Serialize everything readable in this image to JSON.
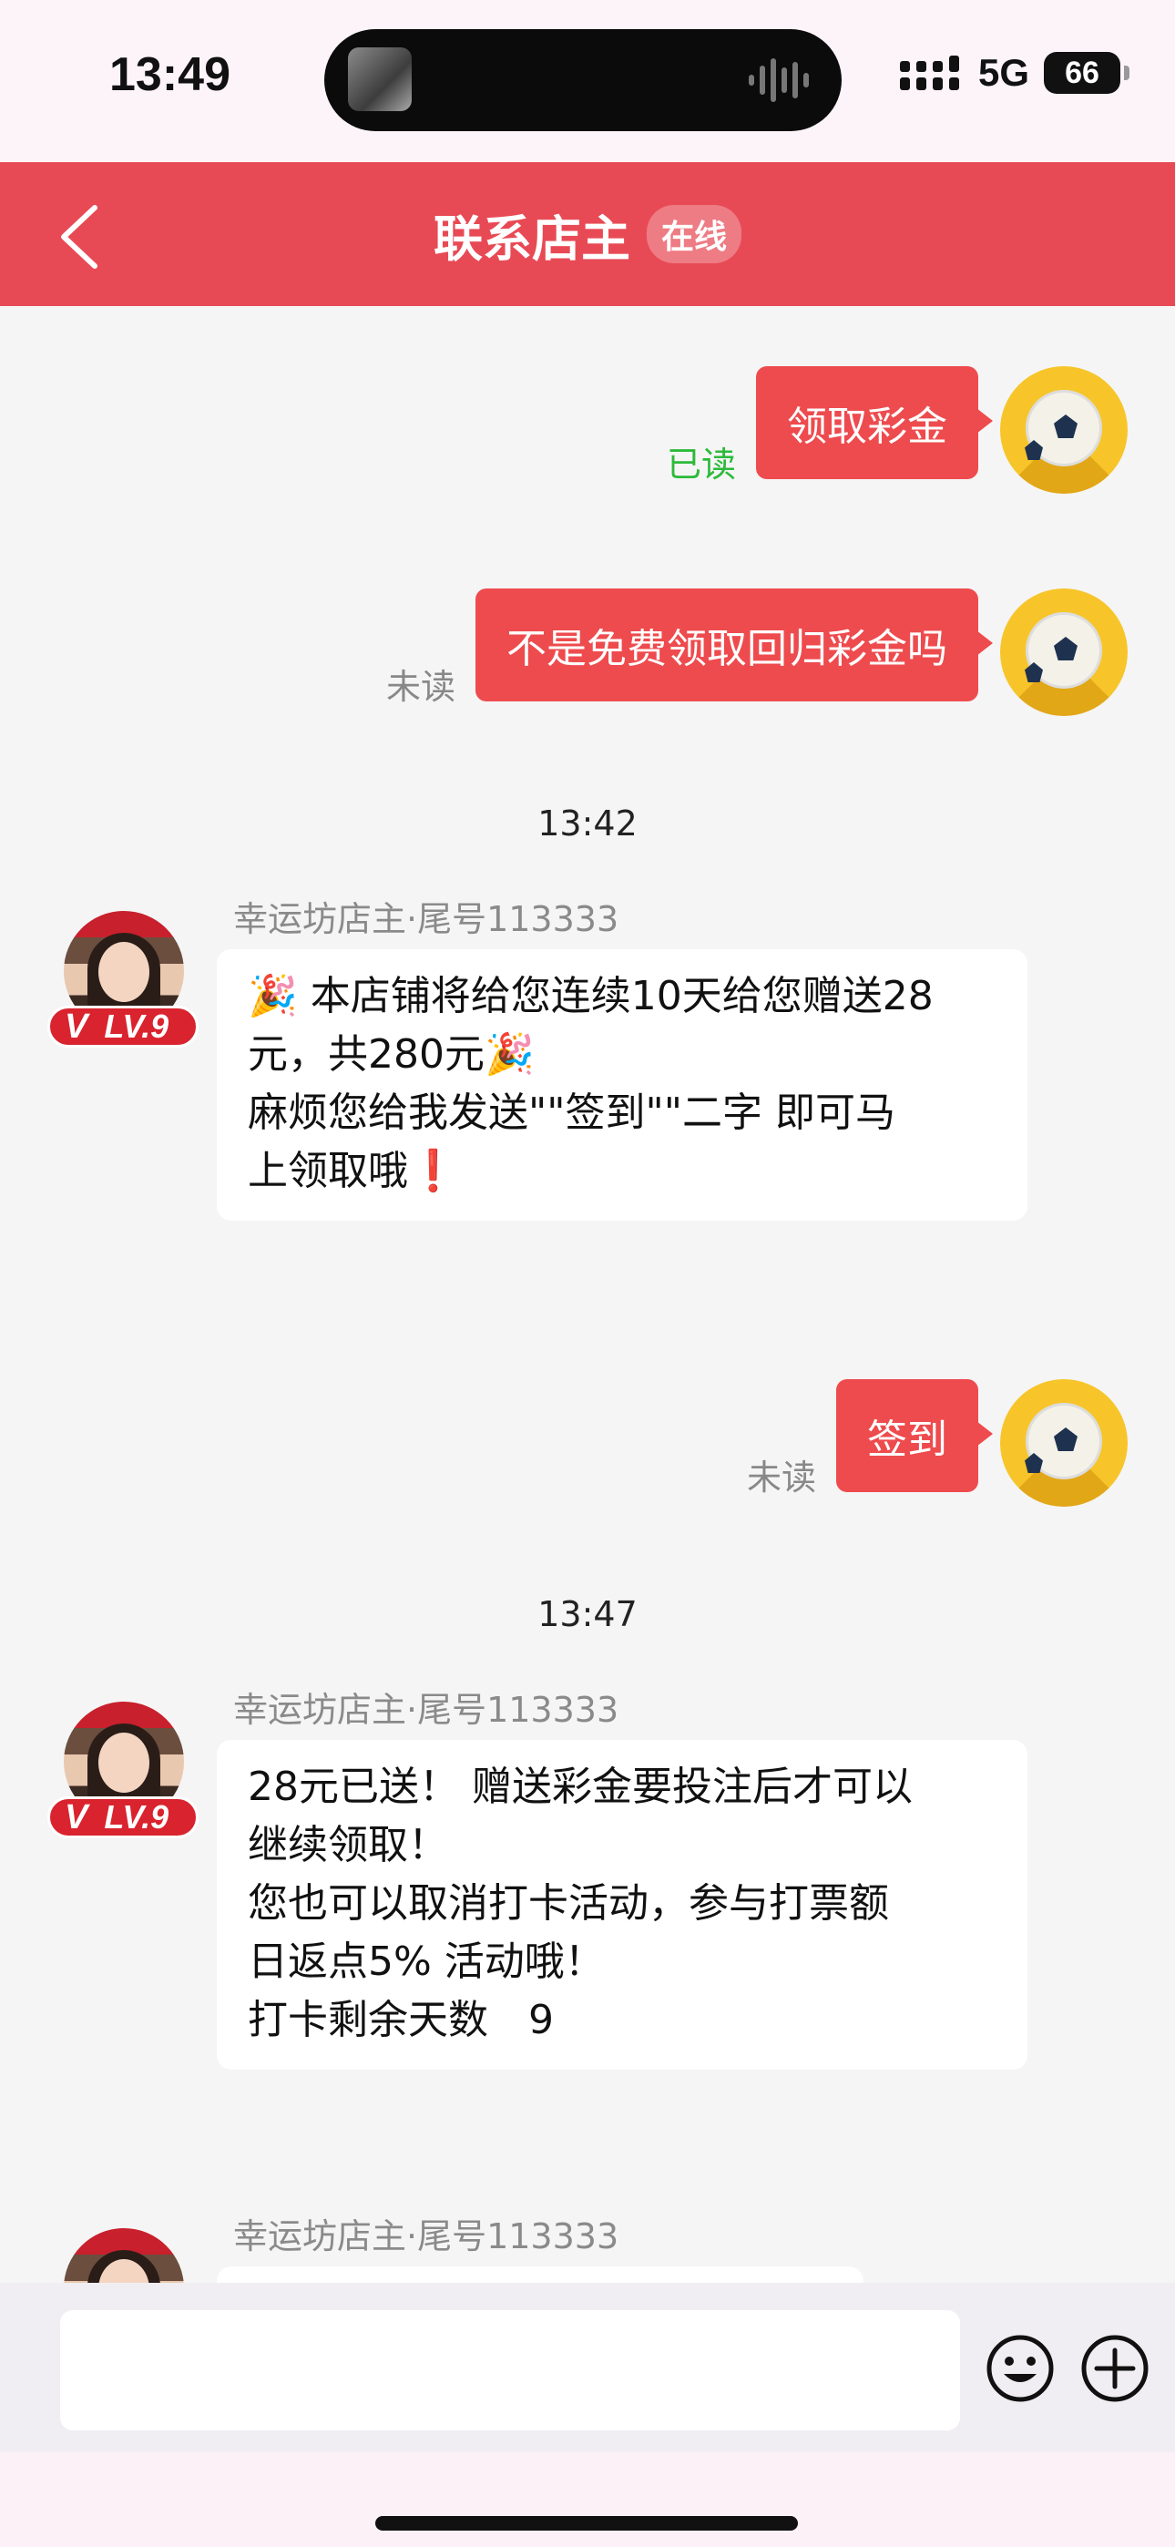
{
  "status_bar": {
    "time": "13:49",
    "network": "5G",
    "battery": "66"
  },
  "header": {
    "title": "联系店主",
    "status_badge": "在线"
  },
  "messages": {
    "out1": {
      "text": "领取彩金",
      "read_status": "已读"
    },
    "out2": {
      "text": "不是免费领取回归彩金吗",
      "read_status": "未读"
    },
    "time1": "13:42",
    "in1": {
      "sender": "幸运坊店主·尾号113333",
      "level": "LV.9",
      "v": "V",
      "lines": [
        "🎉 本店铺将给您连续10天给您赠送28",
        "元，共280元🎉",
        "麻烦您给我发送\"\"签到\"\"二字 即可马",
        "上领取哦❗"
      ]
    },
    "out3": {
      "text": "签到",
      "read_status": "未读"
    },
    "time2": "13:47",
    "in2": {
      "sender": "幸运坊店主·尾号113333",
      "level": "LV.9",
      "v": "V",
      "lines": [
        "28元已送！ 赠送彩金要投注后才可以",
        "继续领取！",
        "您也可以取消打卡活动，参与打票额",
        "日返点5% 活动哦！",
        "打卡剩余天数　9"
      ]
    },
    "in3": {
      "sender": "幸运坊店主·尾号113333"
    }
  },
  "composer": {
    "input_value": ""
  },
  "colors": {
    "brand_red": "#e84a55",
    "bubble_red": "#ee4b4e",
    "read_green": "#2dba3a"
  },
  "icons": [
    "back-chevron-icon",
    "soccer-ball-avatar-icon",
    "emoji-icon",
    "plus-circle-icon"
  ]
}
